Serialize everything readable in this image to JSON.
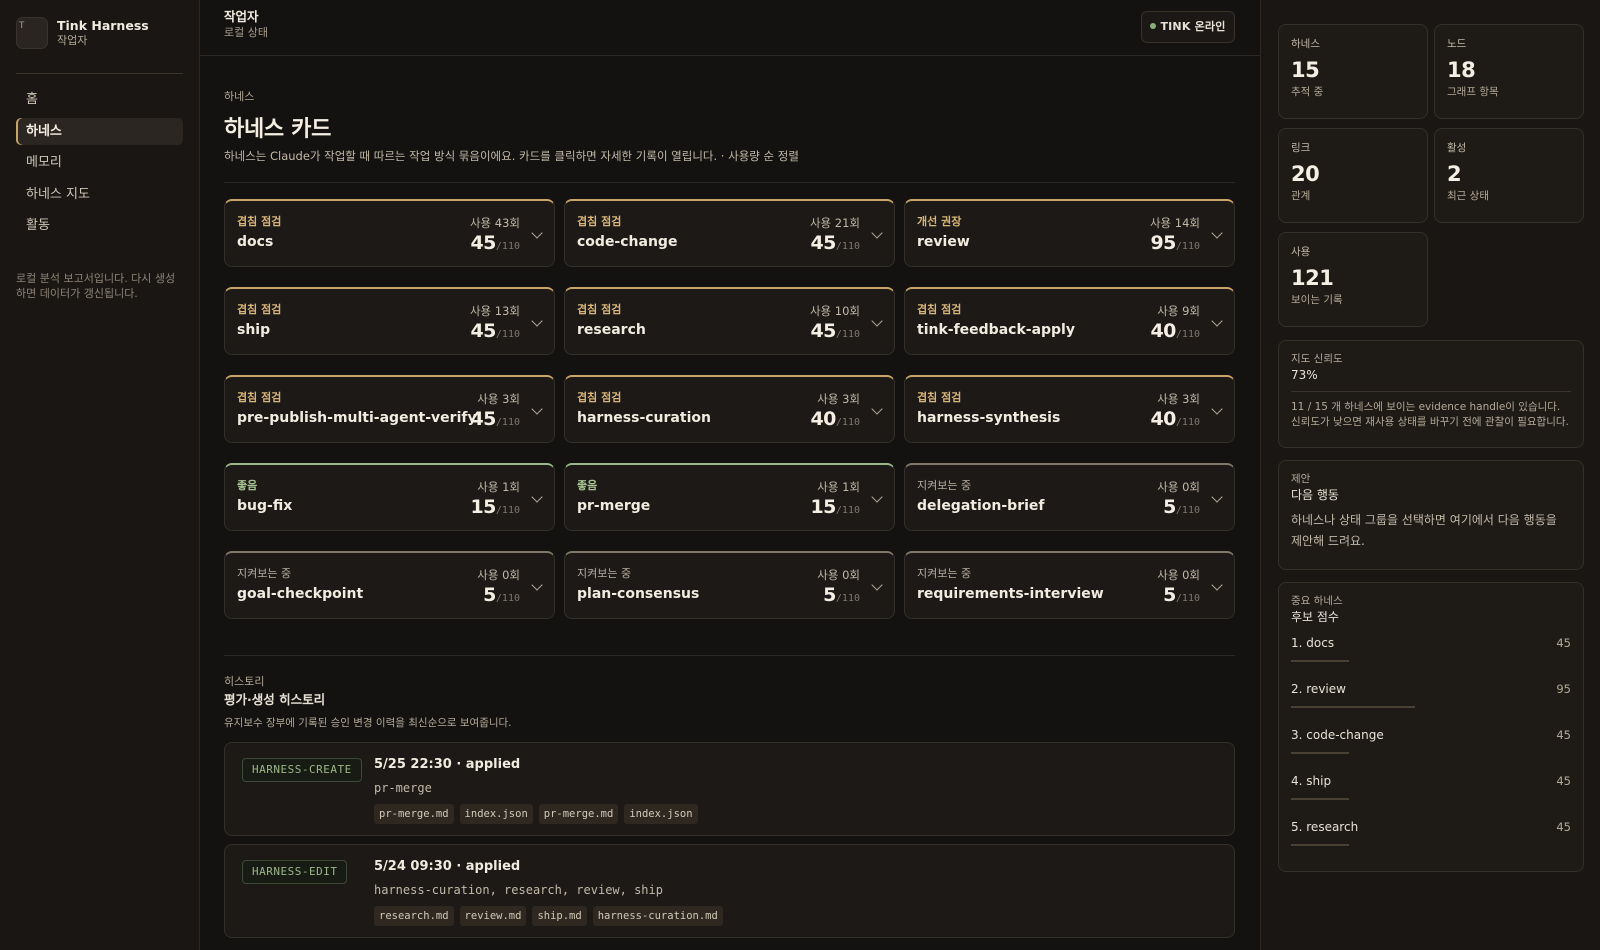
{
  "app": {
    "name": "Tink Harness",
    "role": "작업자",
    "logo_letter": "T"
  },
  "sidebar": {
    "items": [
      {
        "label": "홈",
        "active": false
      },
      {
        "label": "하네스",
        "active": true
      },
      {
        "label": "메모리",
        "active": false
      },
      {
        "label": "하네스 지도",
        "active": false
      },
      {
        "label": "활동",
        "active": false
      }
    ],
    "note": "로컬 분석 보고서입니다. 다시 생성하면 데이터가 갱신됩니다."
  },
  "topbar": {
    "title": "작업자",
    "subtitle": "로컬 상태",
    "status": "TINK 온라인"
  },
  "section": {
    "eyebrow": "하네스",
    "title": "하네스 카드",
    "description": "하네스는 Claude가 작업할 때 따르는 작업 방식 묶음이에요. 카드를 클릭하면 자세한 기록이 열립니다. · 사용량 순 정렬"
  },
  "cards": [
    {
      "status": "겹침 점검",
      "kind": "warn",
      "name": "docs",
      "usage": "사용 43회",
      "score": "45",
      "max": "/110"
    },
    {
      "status": "겹침 점검",
      "kind": "warn",
      "name": "code-change",
      "usage": "사용 21회",
      "score": "45",
      "max": "/110"
    },
    {
      "status": "개선 권장",
      "kind": "warn",
      "name": "review",
      "usage": "사용 14회",
      "score": "95",
      "max": "/110"
    },
    {
      "status": "겹침 점검",
      "kind": "warn",
      "name": "ship",
      "usage": "사용 13회",
      "score": "45",
      "max": "/110"
    },
    {
      "status": "겹침 점검",
      "kind": "warn",
      "name": "research",
      "usage": "사용 10회",
      "score": "45",
      "max": "/110"
    },
    {
      "status": "겹침 점검",
      "kind": "warn",
      "name": "tink-feedback-apply",
      "usage": "사용 9회",
      "score": "40",
      "max": "/110"
    },
    {
      "status": "겹침 점검",
      "kind": "warn",
      "name": "pre-publish-multi-agent-verify",
      "usage": "사용 3회",
      "score": "45",
      "max": "/110"
    },
    {
      "status": "겹침 점검",
      "kind": "warn",
      "name": "harness-curation",
      "usage": "사용 3회",
      "score": "40",
      "max": "/110"
    },
    {
      "status": "겹침 점검",
      "kind": "warn",
      "name": "harness-synthesis",
      "usage": "사용 3회",
      "score": "40",
      "max": "/110"
    },
    {
      "status": "좋음",
      "kind": "good",
      "name": "bug-fix",
      "usage": "사용 1회",
      "score": "15",
      "max": "/110"
    },
    {
      "status": "좋음",
      "kind": "good",
      "name": "pr-merge",
      "usage": "사용 1회",
      "score": "15",
      "max": "/110"
    },
    {
      "status": "지켜보는 중",
      "kind": "watch",
      "name": "delegation-brief",
      "usage": "사용 0회",
      "score": "5",
      "max": "/110"
    },
    {
      "status": "지켜보는 중",
      "kind": "watch",
      "name": "goal-checkpoint",
      "usage": "사용 0회",
      "score": "5",
      "max": "/110"
    },
    {
      "status": "지켜보는 중",
      "kind": "watch",
      "name": "plan-consensus",
      "usage": "사용 0회",
      "score": "5",
      "max": "/110"
    },
    {
      "status": "지켜보는 중",
      "kind": "watch",
      "name": "requirements-interview",
      "usage": "사용 0회",
      "score": "5",
      "max": "/110"
    }
  ],
  "history": {
    "eyebrow": "히스토리",
    "title": "평가·생성 히스토리",
    "description": "유지보수 장부에 기록된 승인 변경 이력을 최신순으로 보여줍니다.",
    "items": [
      {
        "tag": "HARNESS-CREATE",
        "head": "5/25 22:30 · applied",
        "target": "pr-merge",
        "files": [
          "pr-merge.md",
          "index.json",
          "pr-merge.md",
          "index.json"
        ]
      },
      {
        "tag": "HARNESS-EDIT",
        "head": "5/24 09:30 · applied",
        "target": "harness-curation, research, review, ship",
        "files": [
          "research.md",
          "review.md",
          "ship.md",
          "harness-curation.md"
        ]
      }
    ]
  },
  "stats": [
    {
      "label": "하네스",
      "value": "15",
      "caption": "추적 중"
    },
    {
      "label": "노드",
      "value": "18",
      "caption": "그래프 항목"
    },
    {
      "label": "링크",
      "value": "20",
      "caption": "관계"
    },
    {
      "label": "활성",
      "value": "2",
      "caption": "최근 상태"
    },
    {
      "label": "사용",
      "value": "121",
      "caption": "보이는 기록"
    }
  ],
  "confidence": {
    "label": "지도 신뢰도",
    "value": "73%",
    "note": "11 / 15 개 하네스에 보이는 evidence handle이 있습니다. 신뢰도가 낮으면 재사용 상태를 바꾸기 전에 관찰이 필요합니다."
  },
  "suggestion": {
    "label": "제안",
    "title": "다음 행동",
    "body": "하네스나 상태 그룹을 선택하면 여기에서 다음 행동을 제안해 드려요."
  },
  "ranking": {
    "label": "중요 하네스",
    "title": "후보 점수",
    "items": [
      {
        "name": "1. docs",
        "score": "45",
        "fraction": 0.45
      },
      {
        "name": "2. review",
        "score": "95",
        "fraction": 0.95
      },
      {
        "name": "3. code-change",
        "score": "45",
        "fraction": 0.45
      },
      {
        "name": "4. ship",
        "score": "45",
        "fraction": 0.45
      },
      {
        "name": "5. research",
        "score": "45",
        "fraction": 0.45
      }
    ]
  }
}
